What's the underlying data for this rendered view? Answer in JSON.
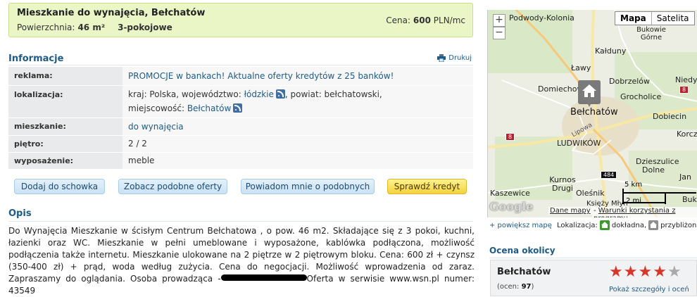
{
  "listing": {
    "title": "Mieszkanie do wynajęcia, Bełchatów",
    "area_label": "Powierzchnia:",
    "area_value": "46 m²",
    "rooms": "3-pokojowe",
    "price_label": "Cena:",
    "price_value": "600",
    "price_unit": "PLN/mc"
  },
  "info": {
    "title": "Informacje",
    "print_label": "Drukuj",
    "rows": [
      {
        "label": "reklama:",
        "value": "PROMOCJE w bankach! Aktualne oferty kredytów z 25 banków!"
      },
      {
        "label": "lokalizacja:",
        "kraj": "kraj: Polska, województwo:",
        "wojewodztwo": "łódzkie",
        "powiat": ", powiat: bełchatowski,",
        "miejscowosc_prefix": "miejscowość:",
        "miejscowosc": "Bełchatów"
      },
      {
        "label": "mieszkanie:",
        "value": "do wynajęcia"
      },
      {
        "label": "piętro:",
        "value": "2 / 2"
      },
      {
        "label": "wyposażenie:",
        "value": "meble"
      }
    ]
  },
  "buttons": {
    "add": "Dodaj do schowka",
    "similar": "Zobacz podobne oferty",
    "notify": "Powiadom mnie o podobnych",
    "credit": "Sprawdź kredyt"
  },
  "opis": {
    "title": "Opis",
    "text_before": "Do Wynajęcia Mieszkanie w ścisłym Centrum Bełchatowa , o pow. 46 m2. Składające się z 3 pokoi, kuchni, łazienki oraz WC. Mieszkanie w pełni umeblowane i wyposażone, kablówka podłączona, możliwość podłączenia także internetu. Mieszkanie ulokowane na 2 piętrze w 2 piętrowym bloku. Cena: 600 zł + czynsz (350-400 zł) + prąd, woda według zużycia. Cena do negocjacji. Możliwość wprowadzenia od zaraz. Zapraszamy do oglądania. Osoba prowadząca -",
    "text_after": "Oferta w serwisie www.wsn.pl numer: 43549"
  },
  "map": {
    "type_map": "Mapa",
    "type_sat": "Satelita",
    "zoom_in": "+",
    "zoom_out": "−",
    "places": {
      "podwody": "Podwody-Kolonia",
      "bukowie": "Bukowie Górne",
      "kaludny": "Kałduny",
      "lawy": "Ławy",
      "dobrzelow": "Dobrzelów",
      "niedys": "Niedys",
      "domiechowice": "Domiechowice",
      "grocholice": "Grocholice",
      "belchatow": "Bełchatów",
      "dobiecin": "Dobiecin",
      "lipowa": "Lipowa",
      "ludwikow": "LUDWIKÓW",
      "korcz": "Korcz",
      "dzieszulice": "Dzieszulice Dolne",
      "kurnos": "Kurnos Drugi",
      "jan": "Jan",
      "kaszewice": "Kaszewice",
      "olesnik": "Oleśnik",
      "buk": "Buk",
      "ksiezy": "Księży Młyn"
    },
    "roads": {
      "r8a": "8",
      "r8b": "8",
      "r484": "484"
    },
    "scale_km": "5 km",
    "scale_mi": "2 mi",
    "google": "Google",
    "dane": "Dane mapy",
    "warunki": "Warunki korzystania z programu"
  },
  "location": {
    "enlarge": "+ powiększ mapę",
    "label": "Lokalizacja:",
    "exact": "dokładna,",
    "approx": "przybliżona"
  },
  "rating": {
    "title": "Ocena okolicy",
    "city": "Bełchatów",
    "count_label": "(ocen:",
    "count": "97",
    "count_close": ")",
    "stars": 4,
    "details": "Pokaż szczegóły i oceń"
  },
  "colors": {
    "accent": "#1e5b88",
    "header_bg": "#eaf6c6",
    "star": "#d9362b"
  }
}
